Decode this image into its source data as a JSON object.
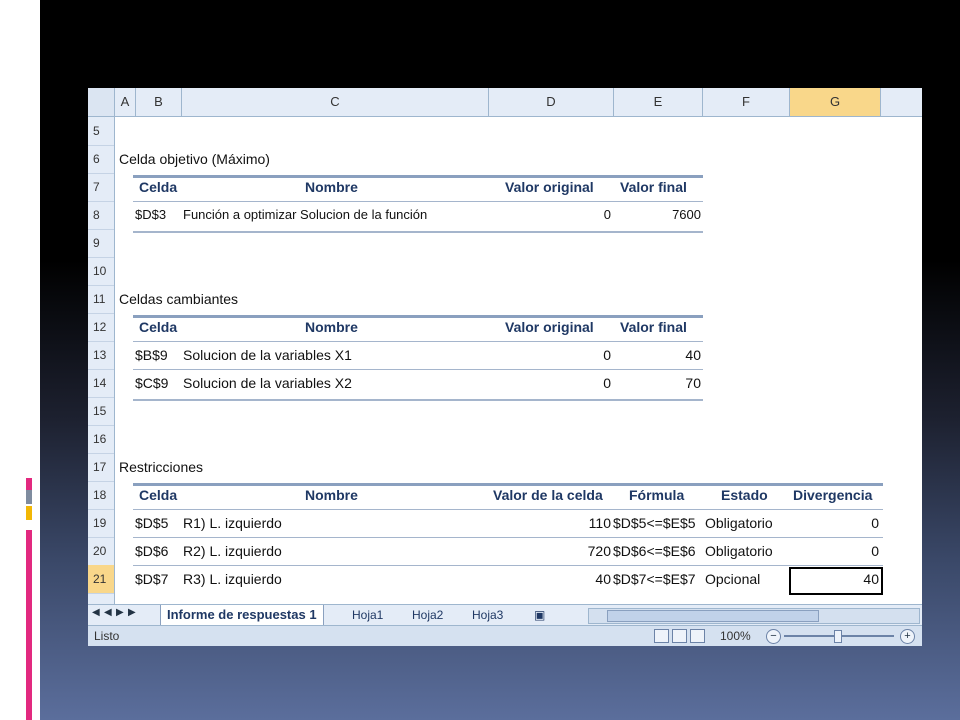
{
  "columns": [
    "A",
    "B",
    "C",
    "D",
    "E",
    "F",
    "G"
  ],
  "rows": [
    "5",
    "6",
    "7",
    "8",
    "9",
    "10",
    "11",
    "12",
    "13",
    "14",
    "15",
    "16",
    "17",
    "18",
    "19",
    "20",
    "21"
  ],
  "selected_column": "G",
  "selected_row": "21",
  "objective": {
    "title": "Celda objetivo (Máximo)",
    "headers": [
      "Celda",
      "Nombre",
      "Valor original",
      "Valor final"
    ],
    "row": {
      "cell": "$D$3",
      "name": "Función a optimizar Solucion de la función",
      "original": "0",
      "final": "7600"
    }
  },
  "changing": {
    "title": "Celdas cambiantes",
    "headers": [
      "Celda",
      "Nombre",
      "Valor original",
      "Valor final"
    ],
    "rows": [
      {
        "cell": "$B$9",
        "name": "Solucion de la variables X1",
        "original": "0",
        "final": "40"
      },
      {
        "cell": "$C$9",
        "name": "Solucion de la variables X2",
        "original": "0",
        "final": "70"
      }
    ]
  },
  "constraints": {
    "title": "Restricciones",
    "headers": [
      "Celda",
      "Nombre",
      "Valor de la celda",
      "Fórmula",
      "Estado",
      "Divergencia"
    ],
    "rows": [
      {
        "cell": "$D$5",
        "name": "R1) L. izquierdo",
        "value": "110",
        "formula": "$D$5<=$E$5",
        "status": "Obligatorio",
        "slack": "0"
      },
      {
        "cell": "$D$6",
        "name": "R2) L. izquierdo",
        "value": "720",
        "formula": "$D$6<=$E$6",
        "status": "Obligatorio",
        "slack": "0"
      },
      {
        "cell": "$D$7",
        "name": "R3) L. izquierdo",
        "value": "40",
        "formula": "$D$7<=$E$7",
        "status": "Opcional",
        "slack": "40"
      }
    ]
  },
  "sheet_tabs": [
    "Informe de respuestas 1",
    "Hoja1",
    "Hoja2",
    "Hoja3"
  ],
  "active_tab": "Informe de respuestas 1",
  "status_bar": {
    "ready": "Listo",
    "zoom": "100%"
  },
  "colors": {
    "header_text": "#1f3864",
    "selected_header": "#f9d78a",
    "accent_pink": "#e2297f",
    "accent_yellow": "#f2b705",
    "accent_gray": "#7f8c9f"
  }
}
